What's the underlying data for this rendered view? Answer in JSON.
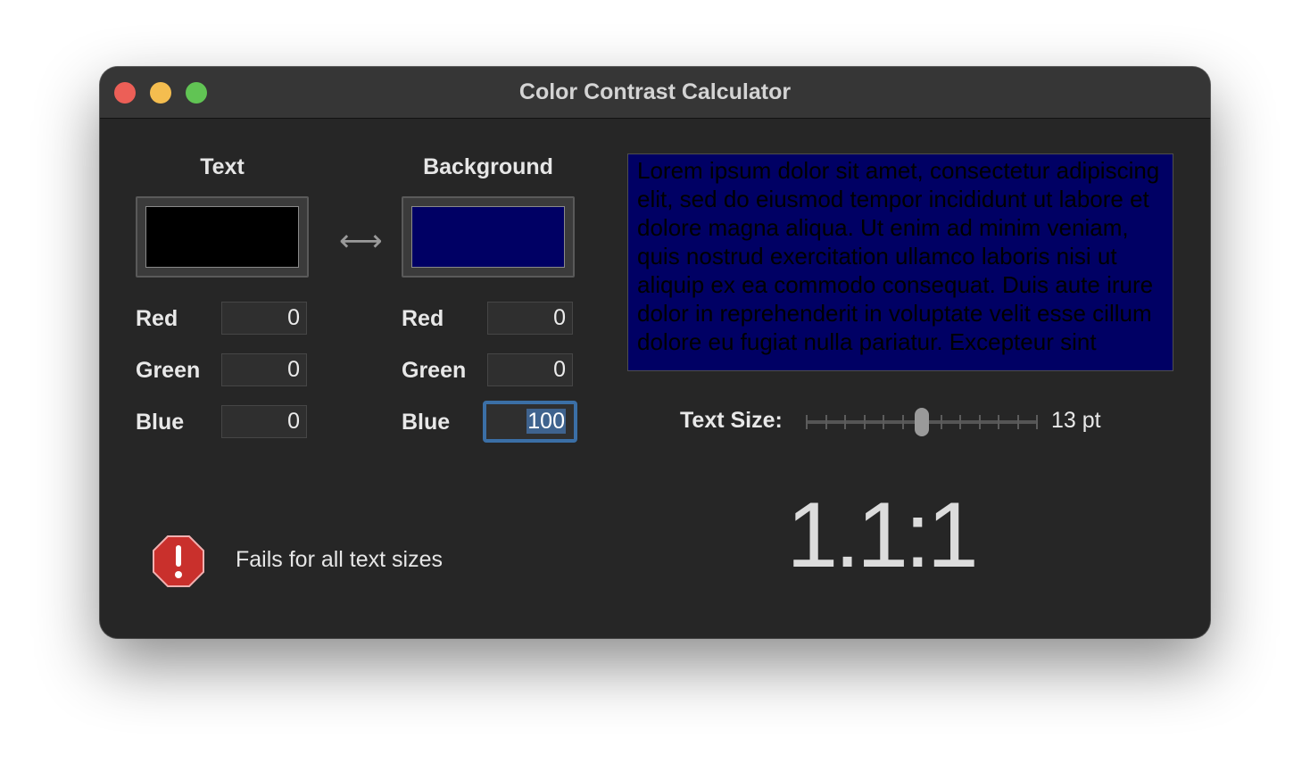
{
  "window": {
    "title": "Color Contrast Calculator"
  },
  "text_color": {
    "heading": "Text",
    "swatch_color": "#000000",
    "red_label": "Red",
    "red_value": "0",
    "green_label": "Green",
    "green_value": "0",
    "blue_label": "Blue",
    "blue_value": "0"
  },
  "background_color": {
    "heading": "Background",
    "swatch_color": "#000064",
    "red_label": "Red",
    "red_value": "0",
    "green_label": "Green",
    "green_value": "0",
    "blue_label": "Blue",
    "blue_value": "100"
  },
  "swap_icon": "swap-arrows-icon",
  "preview": {
    "text": "Lorem ipsum dolor sit amet, consectetur adipiscing elit, sed do eiusmod tempor incididunt ut labore et dolore magna aliqua. Ut enim ad minim veniam, quis nostrud exercitation ullamco laboris nisi ut aliquip ex ea commodo consequat. Duis aute irure dolor in reprehenderit in voluptate velit esse cillum dolore eu fugiat nulla pariatur. Excepteur sint",
    "text_color": "#000000",
    "background_color": "#000064"
  },
  "text_size": {
    "label": "Text Size:",
    "value_label": "13 pt",
    "tick_count": 13,
    "selected_index": 6
  },
  "result": {
    "ratio": "1.1:1",
    "status_text": "Fails for all text sizes",
    "status_icon": "error-stop-icon",
    "status_color": "#c9302c"
  }
}
